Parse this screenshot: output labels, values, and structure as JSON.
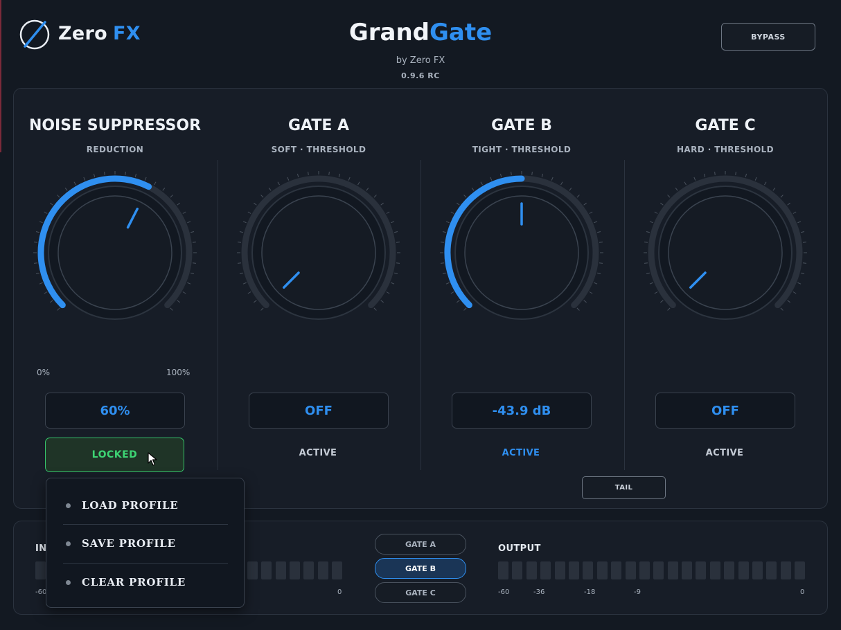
{
  "header": {
    "brand_name": "Zero",
    "brand_accent": "FX",
    "title_main": "Grand",
    "title_accent": "Gate",
    "byline": "by Zero FX",
    "version": "0.9.6 RC",
    "bypass_label": "BYPASS"
  },
  "colors": {
    "accent": "#2f8ff0",
    "locked_green": "#3dd474",
    "track": "#2a313c",
    "background": "#131922"
  },
  "sections": [
    {
      "title": "NOISE SUPPRESSOR",
      "subtitle": "REDUCTION",
      "value": "60%",
      "range_min": "0%",
      "range_max": "100%",
      "knob_level": 0.6,
      "lock_label": "LOCKED"
    },
    {
      "title": "GATE A",
      "subtitle": "SOFT · THRESHOLD",
      "value": "OFF",
      "knob_level": 0.0,
      "active_label": "ACTIVE",
      "active_on": false
    },
    {
      "title": "GATE B",
      "subtitle": "TIGHT · THRESHOLD",
      "value": "-43.9 dB",
      "knob_level": 0.5,
      "active_label": "ACTIVE",
      "active_on": true
    },
    {
      "title": "GATE C",
      "subtitle": "HARD · THRESHOLD",
      "value": "OFF",
      "knob_level": 0.0,
      "active_label": "ACTIVE",
      "active_on": false
    }
  ],
  "tail_label": "TAIL",
  "meters": {
    "input_label": "INPUT",
    "output_label": "OUTPUT",
    "input_scale": [
      "-60",
      "0"
    ],
    "output_scale": [
      "-60",
      "-36",
      "-18",
      "-9",
      "0"
    ],
    "input_level": 0.0,
    "output_level": 0.0
  },
  "gate_selector": {
    "items": [
      "GATE A",
      "GATE B",
      "GATE C"
    ],
    "selected": "GATE B"
  },
  "context_menu": {
    "items": [
      "LOAD PROFILE",
      "SAVE PROFILE",
      "CLEAR PROFILE"
    ]
  }
}
